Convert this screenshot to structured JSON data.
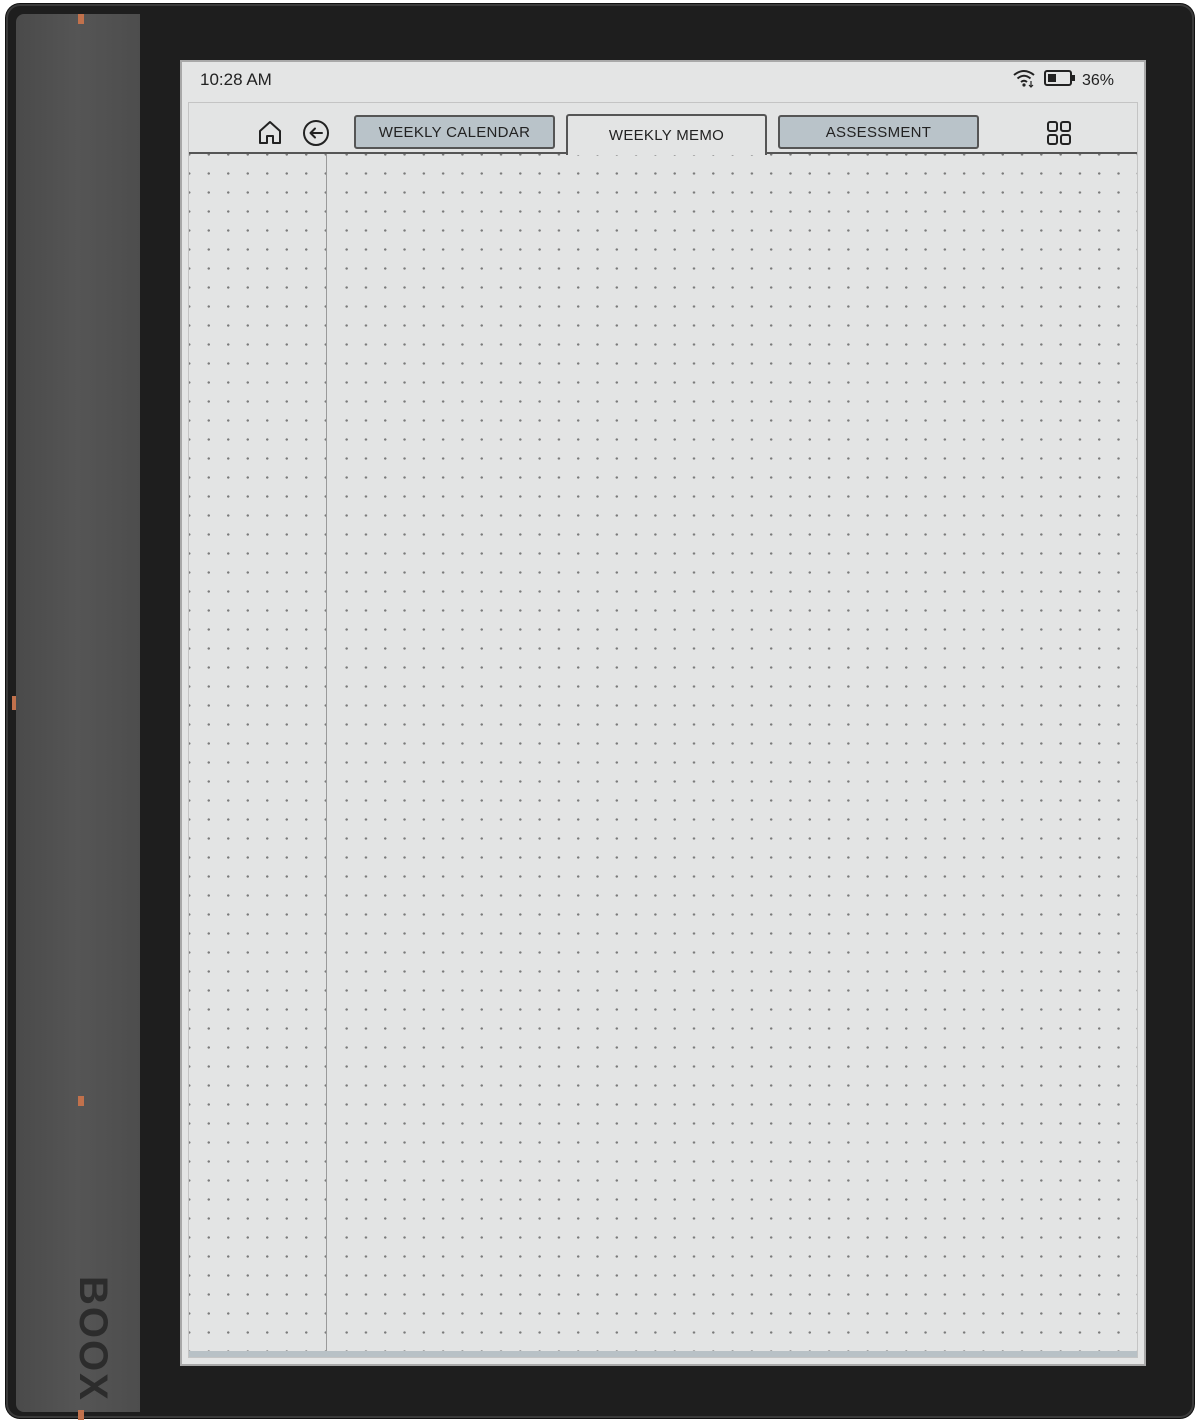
{
  "device": {
    "brand": "BOOX",
    "frame_color": "#1e1e1e",
    "accent_color": "#c1714c"
  },
  "status_bar": {
    "time": "10:28 AM",
    "battery": "36%",
    "icons": [
      "wifi-icon",
      "battery-icon"
    ]
  },
  "toolbar": {
    "home_icon": "home-icon",
    "back_icon": "back-arrow-circle-icon",
    "apps_icon": "grid-icon",
    "tabs": [
      {
        "label": "WEEKLY CALENDAR",
        "state": "inactive"
      },
      {
        "label": "WEEKLY MEMO",
        "state": "active"
      },
      {
        "label": "ASSESSMENT",
        "state": "inactive"
      }
    ],
    "tab_color": "#b9c3c9"
  },
  "page": {
    "style": "dot-grid",
    "background": "#e3e4e4"
  }
}
